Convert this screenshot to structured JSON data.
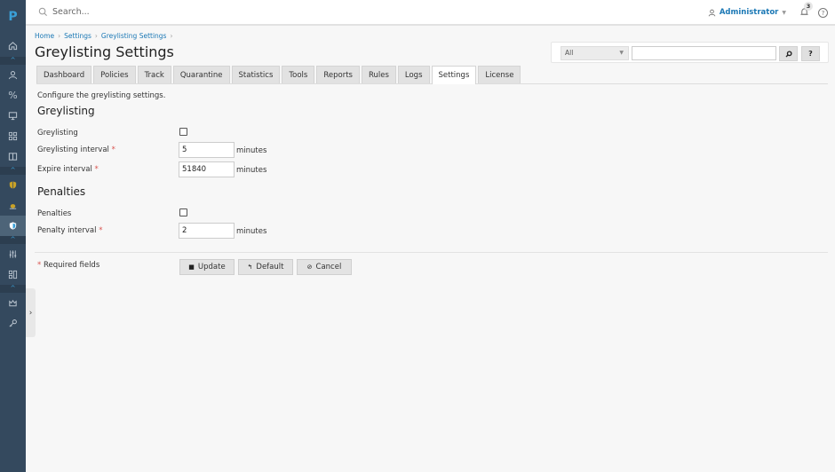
{
  "app": {
    "logo": "P"
  },
  "topbar": {
    "search_placeholder": "Search...",
    "user_label": "Administrator",
    "notification_count": "3",
    "help_label": "?"
  },
  "breadcrumb": [
    "Home",
    "Settings",
    "Greylisting Settings"
  ],
  "page_title": "Greylisting Settings",
  "search_panel": {
    "scope_value": "All",
    "query_value": "",
    "search_button": "⌕",
    "help_button": "?"
  },
  "tabs": [
    {
      "label": "Dashboard",
      "active": false
    },
    {
      "label": "Policies",
      "active": false
    },
    {
      "label": "Track",
      "active": false
    },
    {
      "label": "Quarantine",
      "active": false
    },
    {
      "label": "Statistics",
      "active": false
    },
    {
      "label": "Tools",
      "active": false
    },
    {
      "label": "Reports",
      "active": false
    },
    {
      "label": "Rules",
      "active": false
    },
    {
      "label": "Logs",
      "active": false
    },
    {
      "label": "Settings",
      "active": true
    },
    {
      "label": "License",
      "active": false
    }
  ],
  "form": {
    "description": "Configure the greylisting settings.",
    "greylisting_heading": "Greylisting",
    "greylisting_label": "Greylisting",
    "greylisting_checked": false,
    "greylisting_interval_label": "Greylisting interval",
    "greylisting_interval_value": "5",
    "expire_interval_label": "Expire interval",
    "expire_interval_value": "51840",
    "penalties_heading": "Penalties",
    "penalties_label": "Penalties",
    "penalties_checked": false,
    "penalty_interval_label": "Penalty interval",
    "penalty_interval_value": "2",
    "unit": "minutes",
    "required_marker": "*",
    "required_note": "Required fields"
  },
  "buttons": {
    "update": "Update",
    "default": "Default",
    "cancel": "Cancel"
  },
  "sidebar": {
    "items": [
      {
        "name": "home",
        "active": false
      },
      {
        "name": "users",
        "active": false
      },
      {
        "name": "percent",
        "active": false
      },
      {
        "name": "monitor",
        "active": false
      },
      {
        "name": "apps",
        "active": false
      },
      {
        "name": "book",
        "active": false
      },
      {
        "name": "shield-yellow",
        "active": false
      },
      {
        "name": "bug",
        "active": false
      },
      {
        "name": "shield-blue",
        "active": true
      },
      {
        "name": "sliders",
        "active": false
      },
      {
        "name": "modules",
        "active": false
      },
      {
        "name": "crown",
        "active": false
      },
      {
        "name": "key",
        "active": false
      }
    ]
  },
  "colors": {
    "accent": "#1b78b5",
    "sidebar": "#34495e",
    "required": "#d9534f"
  }
}
